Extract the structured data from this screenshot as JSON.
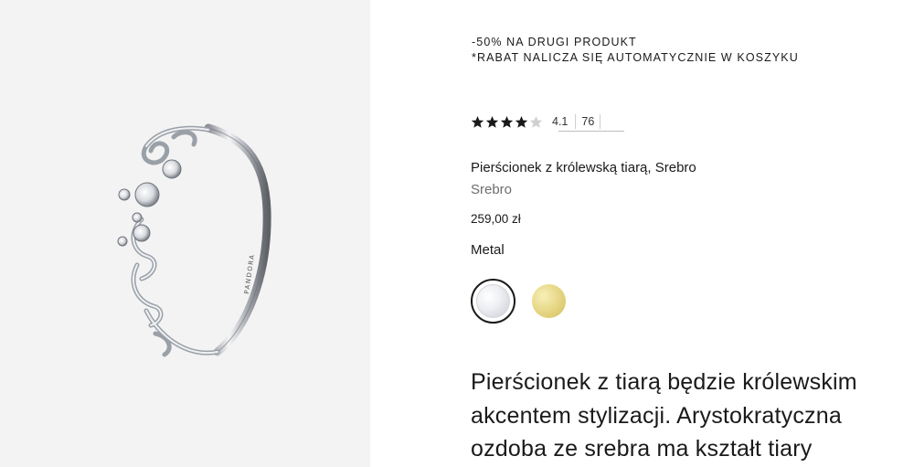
{
  "gallery": {
    "image_alt": "Pierścionek z królewską tiarą, Srebro",
    "engraving": "PANDORA"
  },
  "promo": {
    "line1": "-50% NA DRUGI PRODUKT",
    "line2": "*RABAT NALICZA SIĘ AUTOMATYCZNIE W KOSZYKU"
  },
  "rating": {
    "value": "4.1",
    "stars_filled": 4,
    "stars_total": 5,
    "review_count": "76"
  },
  "product": {
    "title": "Pierścionek z królewską tiarą, Srebro",
    "variant": "Srebro",
    "price": "259,00 zł"
  },
  "metal": {
    "label": "Metal",
    "options": [
      {
        "name": "Srebro",
        "selected": true,
        "color": "#e6e8ec"
      },
      {
        "name": "Złoto",
        "selected": false,
        "color": "#e3d27a"
      }
    ]
  },
  "description": {
    "text": "Pierścionek z tiarą będzie królewskim akcentem stylizacji. Arystokratyczna ozdoba ze srebra ma kształt tiary"
  },
  "colors": {
    "star": "#1a1a1a",
    "star_empty": "#cfcfcf",
    "gallery_bg": "#f3f3f3"
  }
}
